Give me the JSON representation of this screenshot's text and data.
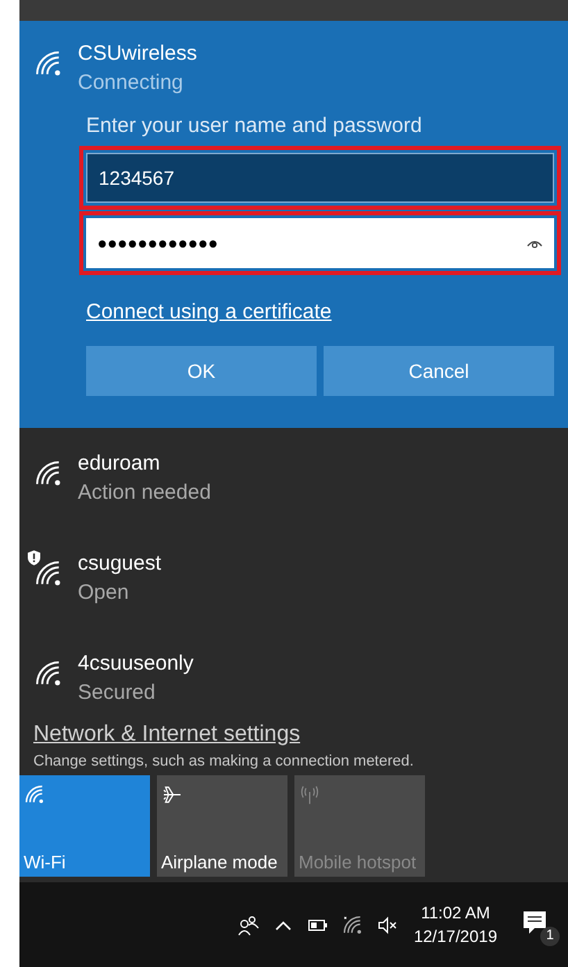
{
  "active_network": {
    "name": "CSUwireless",
    "status": "Connecting",
    "prompt": "Enter your user name and password",
    "username": {
      "value": "1234567",
      "highlighted": true
    },
    "password": {
      "value": "●●●●●●●●●●●●",
      "highlighted": true
    },
    "link": "Connect using a certificate",
    "buttons": [
      "OK",
      "Cancel"
    ]
  },
  "networks": [
    {
      "name": "eduroam",
      "status": "Action needed",
      "warning": false
    },
    {
      "name": "csuguest",
      "status": "Open",
      "warning": true
    },
    {
      "name": "4csuuseonly",
      "status": "Secured",
      "warning": false
    }
  ],
  "settings_link": "Network & Internet settings",
  "settings_hint": "Change settings, such as making a connection metered.",
  "quick_actions": [
    {
      "kind": "wifi",
      "label": "Wi-Fi",
      "on": true,
      "disabled": false
    },
    {
      "kind": "airplane",
      "label": "Airplane mode",
      "on": false,
      "disabled": false
    },
    {
      "kind": "hotspot",
      "label": "Mobile hotspot",
      "on": false,
      "disabled": true
    }
  ],
  "taskbar": {
    "time": "11:02 AM",
    "date": "12/17/2019",
    "notification_count": "1"
  }
}
